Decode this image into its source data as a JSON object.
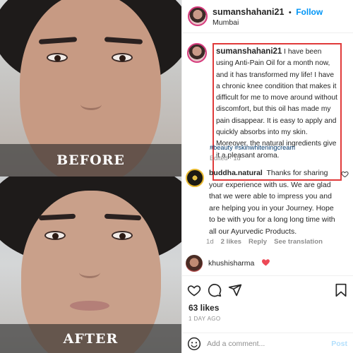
{
  "photo": {
    "before_label": "BEFORE",
    "after_label": "AFTER"
  },
  "header": {
    "username": "sumanshahani21",
    "follow_label": "Follow",
    "location": "Mumbai"
  },
  "caption": {
    "username": "sumanshahani21",
    "text": "I have been using Anti-Pain Oil for a month now, and it has transformed my life! I have a chronic knee condition that makes it difficult for me to move around without discomfort, but this oil has made my pain disappear. It is easy to apply and quickly absorbs into my skin. Moreover, the natural ingredients give it a pleasant aroma.",
    "hashtags": "#beauty #skinwhiteningcream",
    "edited": "Edited · 1d",
    "highlight_color": "#e03a3a"
  },
  "reply": {
    "username": "buddha.natural",
    "text": "Thanks for sharing your experience with us. We are glad that we were able to impress you and are helping you in your Journey. Hope to be with you for a long long time with all our Ayurvedic Products.",
    "age": "1d",
    "likes": "2 likes",
    "reply_label": "Reply",
    "translation_label": "See translation"
  },
  "liker": {
    "username": "khushisharma",
    "heart_color": "#ed4956"
  },
  "actions": {
    "likes": "63 likes",
    "time_ago": "1 DAY AGO"
  },
  "comment_box": {
    "placeholder": "Add a comment...",
    "post_label": "Post"
  },
  "colors": {
    "link": "#0095f6",
    "hashtag": "#00376b"
  }
}
